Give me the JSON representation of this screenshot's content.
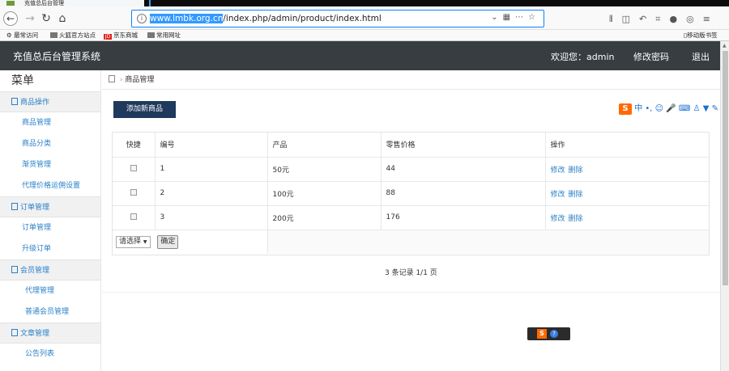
{
  "browser": {
    "tab_title": "充值总后台管理",
    "url_host": "www.lmbk.org.cn",
    "url_path": "/index.php/admin/product/index.html",
    "bookmarks": [
      "最常访问",
      "火狐官方站点",
      "京东商城",
      "常用网址"
    ],
    "mobile_bookmarks": "移动版书签",
    "jd_badge": "JD"
  },
  "header": {
    "title": "充值总后台管理系统",
    "welcome": "欢迎您：admin",
    "change_password": "修改密码",
    "logout": "退出"
  },
  "sidebar": {
    "title": "菜单",
    "groups": [
      {
        "label": "商品操作",
        "items": [
          "商品管理",
          "商品分类",
          "渐货管理",
          "代理价格运佣设置"
        ]
      },
      {
        "label": "订单管理",
        "items": [
          "订单管理",
          "升级订单"
        ]
      },
      {
        "label": "会员管理",
        "items": [
          "代理管理",
          "普通会员管理"
        ]
      },
      {
        "label": "文章管理",
        "items": [
          "公告列表"
        ]
      }
    ]
  },
  "main": {
    "breadcrumb": "商品管理",
    "add_button": "添加新商品",
    "table": {
      "headers": [
        "快捷",
        "编号",
        "产品",
        "零售价格",
        "操作"
      ],
      "rows": [
        {
          "id": "1",
          "product": "50元",
          "price": "44"
        },
        {
          "id": "2",
          "product": "100元",
          "price": "88"
        },
        {
          "id": "3",
          "product": "200元",
          "price": "176"
        }
      ],
      "op_edit": "修改",
      "op_delete": "删除"
    },
    "batch_select": "请选择",
    "confirm_button": "确定",
    "pager": "3 条记录 1/1 页"
  },
  "ime": {
    "logo": "S",
    "lang": "中"
  }
}
